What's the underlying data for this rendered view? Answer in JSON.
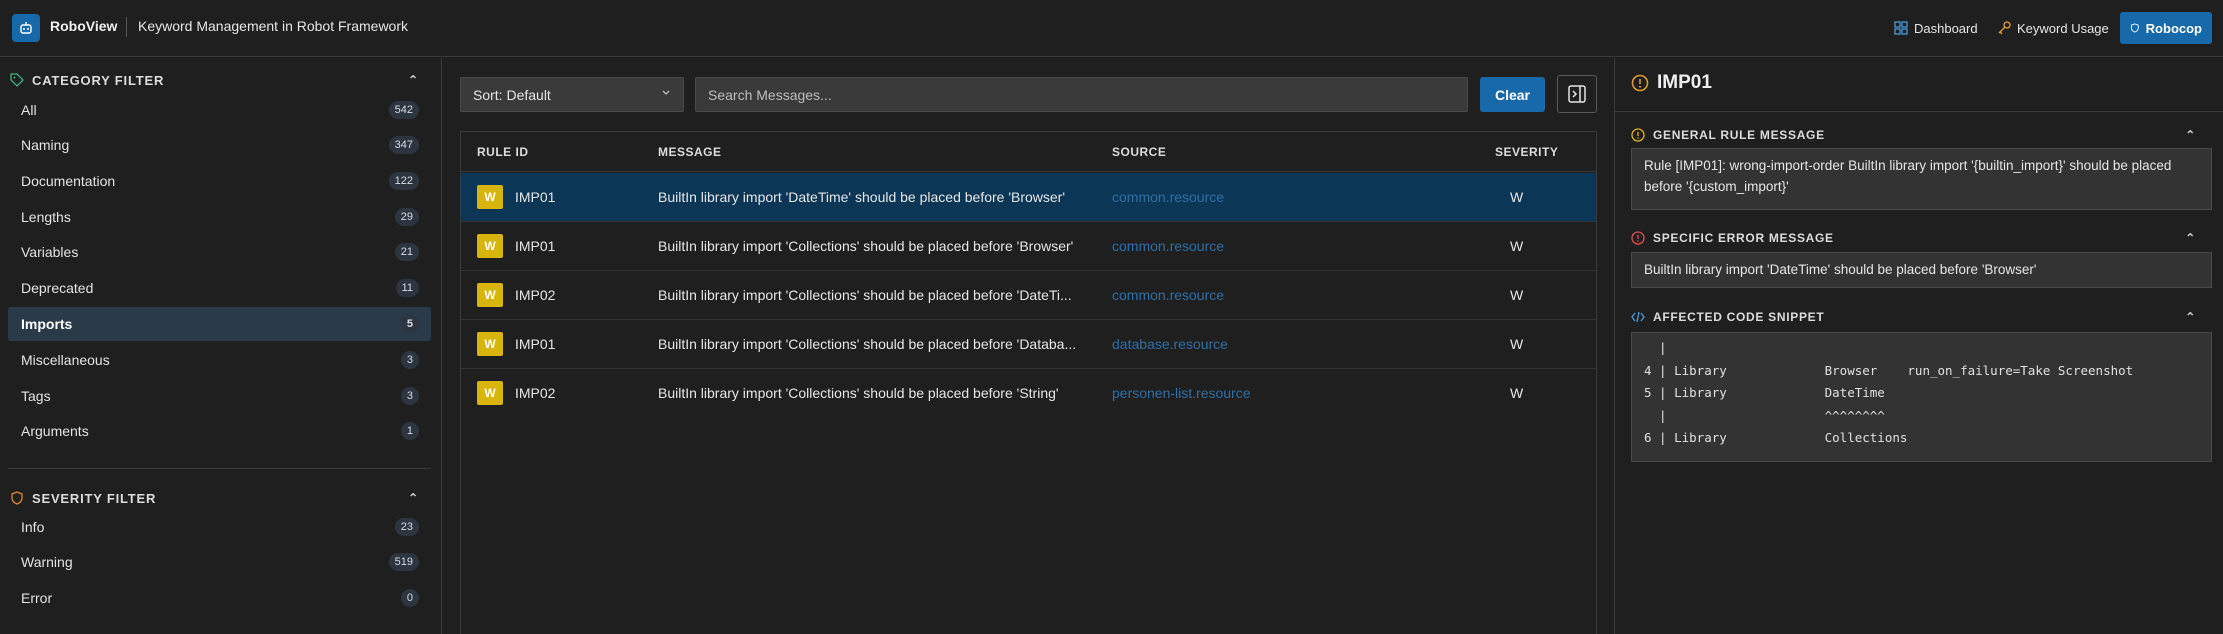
{
  "header": {
    "app_name": "RoboView",
    "subtitle": "Keyword Management in Robot Framework",
    "nav": [
      {
        "label": "Dashboard",
        "icon": "grid-icon"
      },
      {
        "label": "Keyword Usage",
        "icon": "key-icon"
      },
      {
        "label": "Robocop",
        "icon": "shield-icon",
        "active": true
      }
    ]
  },
  "sidebar": {
    "category_title": "CATEGORY FILTER",
    "categories": [
      {
        "label": "All",
        "count": "542"
      },
      {
        "label": "Naming",
        "count": "347"
      },
      {
        "label": "Documentation",
        "count": "122"
      },
      {
        "label": "Lengths",
        "count": "29"
      },
      {
        "label": "Variables",
        "count": "21"
      },
      {
        "label": "Deprecated",
        "count": "11"
      },
      {
        "label": "Imports",
        "count": "5",
        "active": true
      },
      {
        "label": "Miscellaneous",
        "count": "3"
      },
      {
        "label": "Tags",
        "count": "3"
      },
      {
        "label": "Arguments",
        "count": "1"
      }
    ],
    "severity_title": "SEVERITY FILTER",
    "severities": [
      {
        "label": "Info",
        "count": "23"
      },
      {
        "label": "Warning",
        "count": "519"
      },
      {
        "label": "Error",
        "count": "0"
      }
    ]
  },
  "toolbar": {
    "sort_label": "Sort: Default",
    "search_placeholder": "Search Messages...",
    "clear_label": "Clear"
  },
  "table": {
    "columns": [
      "RULE ID",
      "MESSAGE",
      "SOURCE",
      "SEVERITY"
    ],
    "rows": [
      {
        "badge": "W",
        "rule": "IMP01",
        "message": "BuiltIn library import 'DateTime' should be placed before 'Browser'",
        "source": "common.resource",
        "severity": "W",
        "selected": true
      },
      {
        "badge": "W",
        "rule": "IMP01",
        "message": "BuiltIn library import 'Collections' should be placed before 'Browser'",
        "source": "common.resource",
        "severity": "W"
      },
      {
        "badge": "W",
        "rule": "IMP02",
        "message": "BuiltIn library import 'Collections' should be placed before 'DateTi...",
        "source": "common.resource",
        "severity": "W"
      },
      {
        "badge": "W",
        "rule": "IMP01",
        "message": "BuiltIn library import 'Collections' should be placed before 'Databa...",
        "source": "database.resource",
        "severity": "W"
      },
      {
        "badge": "W",
        "rule": "IMP02",
        "message": "BuiltIn library import 'Collections' should be placed before 'String'",
        "source": "personen-list.resource",
        "severity": "W"
      }
    ]
  },
  "details": {
    "title": "IMP01",
    "general_title": "GENERAL RULE MESSAGE",
    "general_text": "Rule [IMP01]: wrong-import-order BuiltIn library import '{builtin_import}' should be placed before '{custom_import}'",
    "specific_title": "SPECIFIC ERROR MESSAGE",
    "specific_text": "BuiltIn library import 'DateTime' should be placed before 'Browser'",
    "snippet_title": "AFFECTED CODE SNIPPET",
    "snippet_lines": [
      "  |",
      "4 | Library             Browser    run_on_failure=Take Screenshot",
      "5 | Library             DateTime",
      "  |                     ^^^^^^^^",
      "6 | Library             Collections"
    ]
  },
  "colors": {
    "accent": "#1769aa",
    "warning_badge": "#d8b40d",
    "selected_row": "#0c3656",
    "link": "#2f6ea5"
  }
}
